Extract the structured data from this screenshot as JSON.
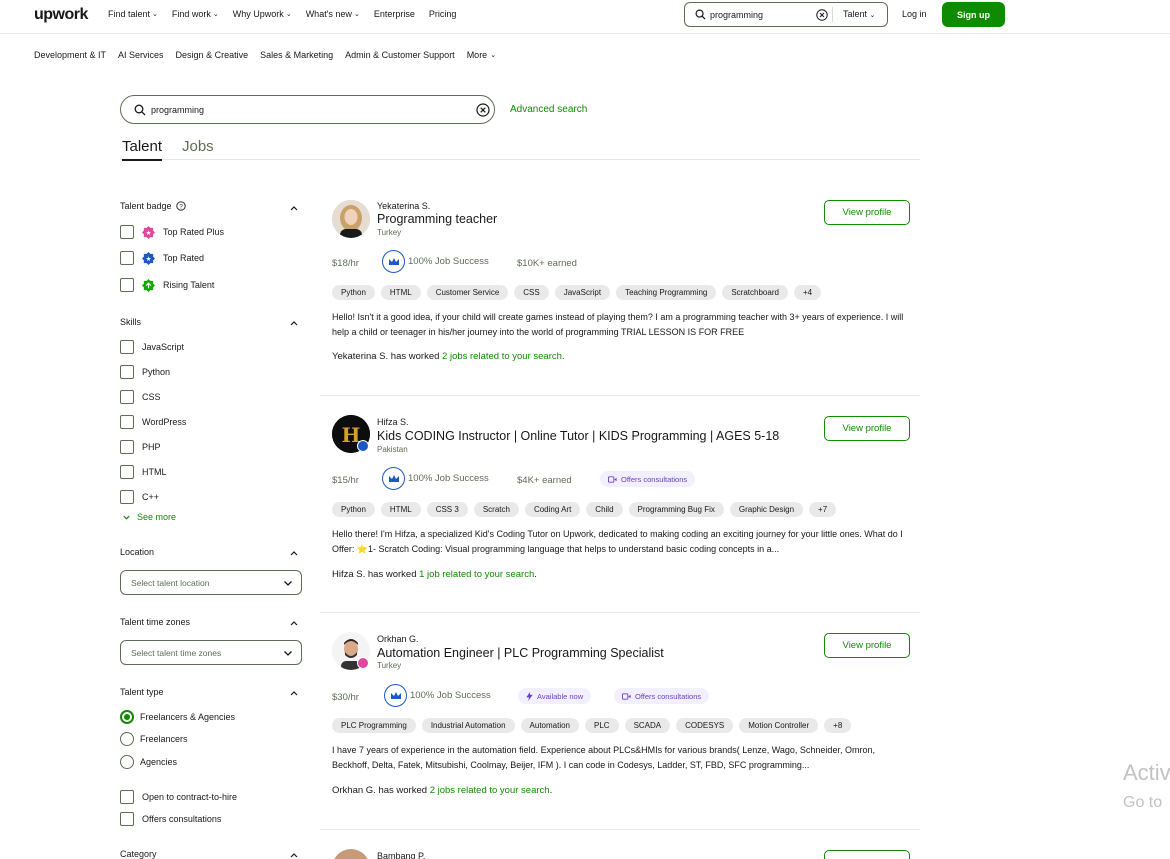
{
  "topnav": {
    "logo": "upwork",
    "items": [
      "Find talent",
      "Find work",
      "Why Upwork",
      "What's new",
      "Enterprise",
      "Pricing"
    ],
    "search_value": "programming",
    "search_scope": "Talent",
    "login": "Log in",
    "signup": "Sign up"
  },
  "subnav": {
    "items": [
      "Development & IT",
      "AI Services",
      "Design & Creative",
      "Sales & Marketing",
      "Admin & Customer Support",
      "More"
    ]
  },
  "search": {
    "value": "programming",
    "advanced": "Advanced search"
  },
  "tabs": {
    "talent": "Talent",
    "jobs": "Jobs"
  },
  "filters": {
    "talent_badge": {
      "title": "Talent badge",
      "options": [
        "Top Rated Plus",
        "Top Rated",
        "Rising Talent"
      ]
    },
    "skills": {
      "title": "Skills",
      "options": [
        "JavaScript",
        "Python",
        "CSS",
        "WordPress",
        "PHP",
        "HTML",
        "C++"
      ],
      "see_more": "See more"
    },
    "location": {
      "title": "Location",
      "placeholder": "Select talent location"
    },
    "time_zones": {
      "title": "Talent time zones",
      "placeholder": "Select talent time zones"
    },
    "talent_type": {
      "title": "Talent type",
      "options": [
        "Freelancers & Agencies",
        "Freelancers",
        "Agencies"
      ],
      "selected": "Freelancers & Agencies"
    },
    "extras": [
      "Open to contract-to-hire",
      "Offers consultations"
    ],
    "category": {
      "title": "Category"
    }
  },
  "freelancers": [
    {
      "name": "Yekaterina S.",
      "title": "Programming teacher",
      "location": "Turkey",
      "rate": "$18/hr",
      "job_success": "100% Job Success",
      "earned": "$10K+ earned",
      "skills": [
        "Python",
        "HTML",
        "Customer Service",
        "CSS",
        "JavaScript",
        "Teaching Programming",
        "Scratchboard",
        "+4"
      ],
      "description": "Hello! Isn't it a good idea, if your child will create games instead of playing them? I am a programming teacher with 3+ years of experience. I will help a child or teenager in his/her journey into the world of programming TRIAL LESSON IS FOR FREE",
      "worked_prefix": "Yekaterina S. has worked",
      "worked_link": "2 jobs related to your search",
      "view": "View profile"
    },
    {
      "name": "Hifza S.",
      "title": "Kids CODING Instructor | Online Tutor | KIDS Programming | AGES 5-18",
      "location": "Pakistan",
      "rate": "$15/hr",
      "job_success": "100% Job Success",
      "earned": "$4K+ earned",
      "consult": "Offers consultations",
      "skills": [
        "Python",
        "HTML",
        "CSS 3",
        "Scratch",
        "Coding Art",
        "Child",
        "Programming Bug Fix",
        "Graphic Design",
        "+7"
      ],
      "description": "Hello there! I'm Hifza, a specialized Kid's Coding Tutor on Upwork, dedicated to making coding an exciting journey for your little ones.  What do I Offer: ⭐1- Scratch Coding: Visual programming language that helps to understand basic coding concepts in a...",
      "worked_prefix": "Hifza S. has worked",
      "worked_link": "1 job related to your search",
      "view": "View profile"
    },
    {
      "name": "Orkhan G.",
      "title": "Automation Engineer | PLC Programming Specialist",
      "location": "Turkey",
      "rate": "$30/hr",
      "job_success": "100% Job Success",
      "available": "Available now",
      "consult": "Offers consultations",
      "skills": [
        "PLC Programming",
        "Industrial Automation",
        "Automation",
        "PLC",
        "SCADA",
        "CODESYS",
        "Motion Controller",
        "+8"
      ],
      "description": "I have 7 years of experience in the automation field. Experience about PLCs&HMIs for various brands( Lenze, Wago, Schneider, Omron, Beckhoff, Delta, Fatek, Mitsubishi, Coolmay, Beijer, IFM ). I can code in Codesys, Ladder, ST, FBD, SFC programming...",
      "worked_prefix": "Orkhan G. has worked",
      "worked_link": "2 jobs related to your search",
      "view": "View profile"
    },
    {
      "name": "Bambang P."
    }
  ],
  "watermark": {
    "line1": "Activ",
    "line2": "Go to"
  },
  "colors": {
    "brand": "#108a00",
    "text": "#181818",
    "muted": "#5e6d55",
    "consult": "#6b3fc4"
  }
}
